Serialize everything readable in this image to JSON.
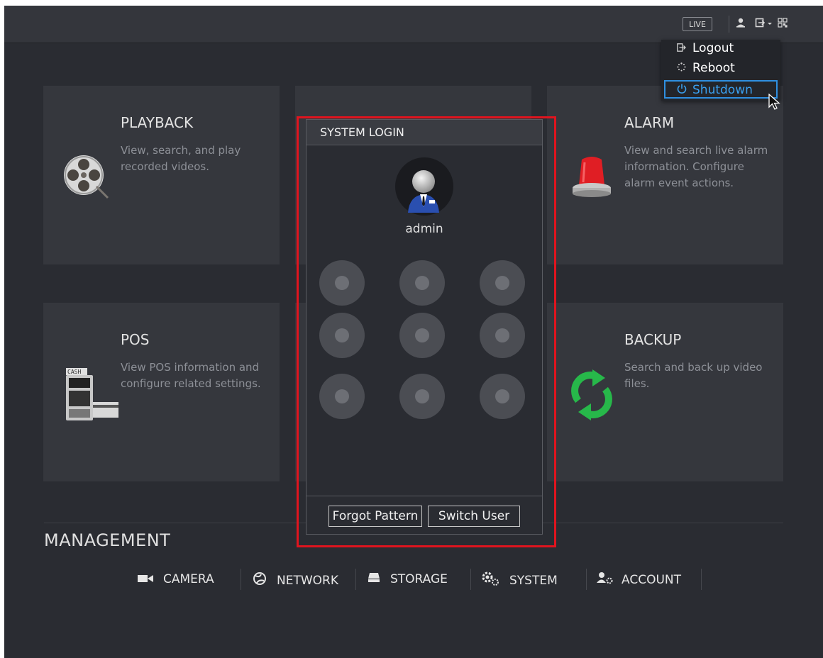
{
  "topbar": {
    "live_label": "LIVE",
    "icons": [
      "user-icon",
      "logout-menu-icon",
      "qr-code-icon"
    ]
  },
  "dropdown": {
    "items": [
      {
        "label": "Logout",
        "icon": "logout-icon"
      },
      {
        "label": "Reboot",
        "icon": "reboot-icon"
      },
      {
        "label": "Shutdown",
        "icon": "power-icon",
        "selected": true
      }
    ]
  },
  "tiles": {
    "playback": {
      "title": "PLAYBACK",
      "desc_line1": "View, search, and play",
      "desc_line2": "recorded videos.",
      "icon": "film-reel-icon"
    },
    "alarm": {
      "title": "ALARM",
      "desc_line1": "View and search live alarm",
      "desc_line2": "information. Configure",
      "desc_line3": "alarm event actions.",
      "icon": "siren-icon"
    },
    "pos": {
      "title": "POS",
      "desc_line1": "View POS information and",
      "desc_line2": "configure related settings.",
      "icon": "cash-register-icon",
      "register_text": "CASH"
    },
    "backup": {
      "title": "BACKUP",
      "desc_line1": "Search and back up video",
      "desc_line2": "files.",
      "icon": "refresh-arrows-icon"
    }
  },
  "login": {
    "title": "SYSTEM LOGIN",
    "username": "admin",
    "forgot_label": "Forgot Pattern",
    "switch_label": "Switch User",
    "pattern_dots": 9
  },
  "management": {
    "title": "MANAGEMENT",
    "items": [
      {
        "label": "CAMERA",
        "icon": "camera-icon"
      },
      {
        "label": "NETWORK",
        "icon": "network-globe-icon"
      },
      {
        "label": "STORAGE",
        "icon": "hard-drive-icon"
      },
      {
        "label": "SYSTEM",
        "icon": "gears-icon"
      },
      {
        "label": "ACCOUNT",
        "icon": "account-settings-icon"
      }
    ]
  },
  "colors": {
    "background": "#2a2c32",
    "tile": "#35373d",
    "highlight": "#e0141e",
    "selected": "#2f8fe0"
  }
}
